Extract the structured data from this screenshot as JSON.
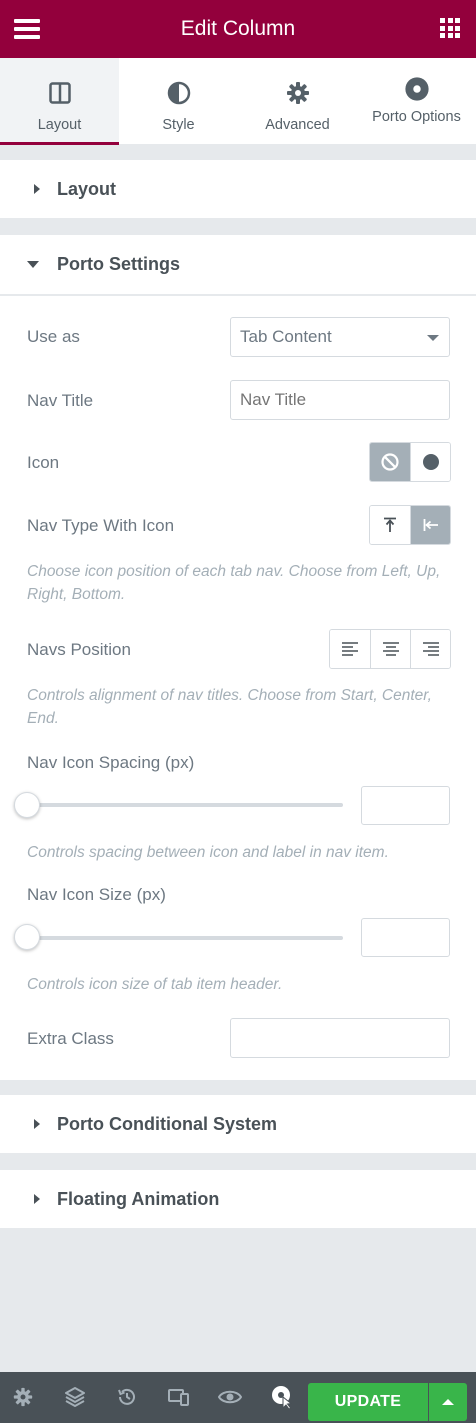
{
  "header": {
    "title": "Edit Column"
  },
  "tabs": [
    {
      "label": "Layout",
      "icon": "columns-icon",
      "active": true
    },
    {
      "label": "Style",
      "icon": "half-circle-icon",
      "active": false
    },
    {
      "label": "Advanced",
      "icon": "gear-icon",
      "active": false
    },
    {
      "label": "Porto Options",
      "icon": "target-icon",
      "active": false
    }
  ],
  "sections": {
    "layout": "Layout",
    "porto_settings": "Porto Settings",
    "conditional": "Porto Conditional System",
    "floating": "Floating Animation"
  },
  "fields": {
    "use_as": {
      "label": "Use as",
      "value": "Tab Content"
    },
    "nav_title": {
      "label": "Nav Title",
      "placeholder": "Nav Title"
    },
    "icon": {
      "label": "Icon"
    },
    "nav_type": {
      "label": "Nav Type With Icon",
      "description": "Choose icon position of each tab nav. Choose from Left, Up, Right, Bottom."
    },
    "navs_position": {
      "label": "Navs Position",
      "description": "Controls alignment of nav titles. Choose from Start, Center, End."
    },
    "nav_icon_spacing": {
      "label": "Nav Icon Spacing (px)",
      "description": "Controls spacing between icon and label in nav item.",
      "value": 0
    },
    "nav_icon_size": {
      "label": "Nav Icon Size (px)",
      "description": "Controls icon size of tab item header.",
      "value": 0
    },
    "extra_class": {
      "label": "Extra Class",
      "value": ""
    }
  },
  "footer": {
    "update_label": "UPDATE"
  },
  "colors": {
    "brand": "#93003c",
    "update": "#39b54a",
    "footer": "#495157"
  }
}
